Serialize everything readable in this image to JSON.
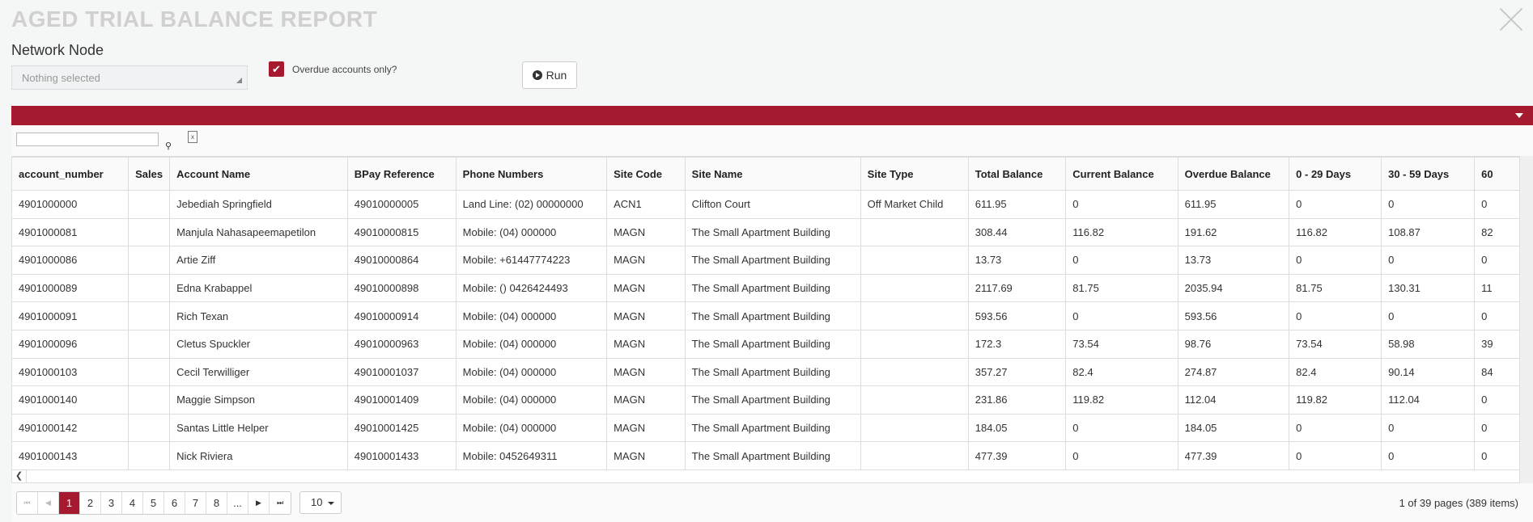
{
  "title": "AGED TRIAL BALANCE REPORT",
  "filters": {
    "network_node_label": "Network Node",
    "network_node_placeholder": "Nothing selected",
    "overdue_label": "Overdue accounts only?",
    "overdue_checked": true,
    "run_label": "Run"
  },
  "colors": {
    "accent": "#a51a2e"
  },
  "table": {
    "headers": [
      "account_number",
      "Sales",
      "Account Name",
      "BPay Reference",
      "Phone Numbers",
      "Site Code",
      "Site Name",
      "Site Type",
      "Total Balance",
      "Current Balance",
      "Overdue Balance",
      "0 - 29 Days",
      "30 - 59 Days",
      "60"
    ],
    "rows": [
      [
        "4901000000",
        "",
        "Jebediah Springfield",
        "49010000005",
        "Land Line: (02) 00000000",
        "ACN1",
        "Clifton Court",
        "Off Market Child",
        "611.95",
        "0",
        "611.95",
        "0",
        "0",
        "0"
      ],
      [
        "4901000081",
        "",
        "Manjula Nahasapeemapetilon",
        "49010000815",
        "Mobile: (04) 000000",
        "MAGN",
        "The Small Apartment Building",
        "",
        "308.44",
        "116.82",
        "191.62",
        "116.82",
        "108.87",
        "82"
      ],
      [
        "4901000086",
        "",
        "Artie Ziff",
        "49010000864",
        "Mobile: +61447774223",
        "MAGN",
        "The Small Apartment Building",
        "",
        "13.73",
        "0",
        "13.73",
        "0",
        "0",
        "0"
      ],
      [
        "4901000089",
        "",
        "Edna Krabappel",
        "49010000898",
        "Mobile: () 0426424493",
        "MAGN",
        "The Small Apartment Building",
        "",
        "2117.69",
        "81.75",
        "2035.94",
        "81.75",
        "130.31",
        "11"
      ],
      [
        "4901000091",
        "",
        "Rich Texan",
        "49010000914",
        "Mobile: (04) 000000",
        "MAGN",
        "The Small Apartment Building",
        "",
        "593.56",
        "0",
        "593.56",
        "0",
        "0",
        "0"
      ],
      [
        "4901000096",
        "",
        "Cletus Spuckler",
        "49010000963",
        "Mobile: (04) 000000",
        "MAGN",
        "The Small Apartment Building",
        "",
        "172.3",
        "73.54",
        "98.76",
        "73.54",
        "58.98",
        "39"
      ],
      [
        "4901000103",
        "",
        "Cecil Terwilliger",
        "49010001037",
        "Mobile: (04) 000000",
        "MAGN",
        "The Small Apartment Building",
        "",
        "357.27",
        "82.4",
        "274.87",
        "82.4",
        "90.14",
        "84"
      ],
      [
        "4901000140",
        "",
        "Maggie Simpson",
        "49010001409",
        "Mobile: (04) 000000",
        "MAGN",
        "The Small Apartment Building",
        "",
        "231.86",
        "119.82",
        "112.04",
        "119.82",
        "112.04",
        "0"
      ],
      [
        "4901000142",
        "",
        "Santas Little Helper",
        "49010001425",
        "Mobile: (04) 000000",
        "MAGN",
        "The Small Apartment Building",
        "",
        "184.05",
        "0",
        "184.05",
        "0",
        "0",
        "0"
      ],
      [
        "4901000143",
        "",
        "Nick Riviera",
        "49010001433",
        "Mobile: 0452649311",
        "MAGN",
        "The Small Apartment Building",
        "",
        "477.39",
        "0",
        "477.39",
        "0",
        "0",
        "0"
      ]
    ]
  },
  "pager": {
    "pages": [
      "1",
      "2",
      "3",
      "4",
      "5",
      "6",
      "7",
      "8",
      "..."
    ],
    "current": "1",
    "page_size": "10",
    "info": "1 of 39 pages (389 items)"
  }
}
